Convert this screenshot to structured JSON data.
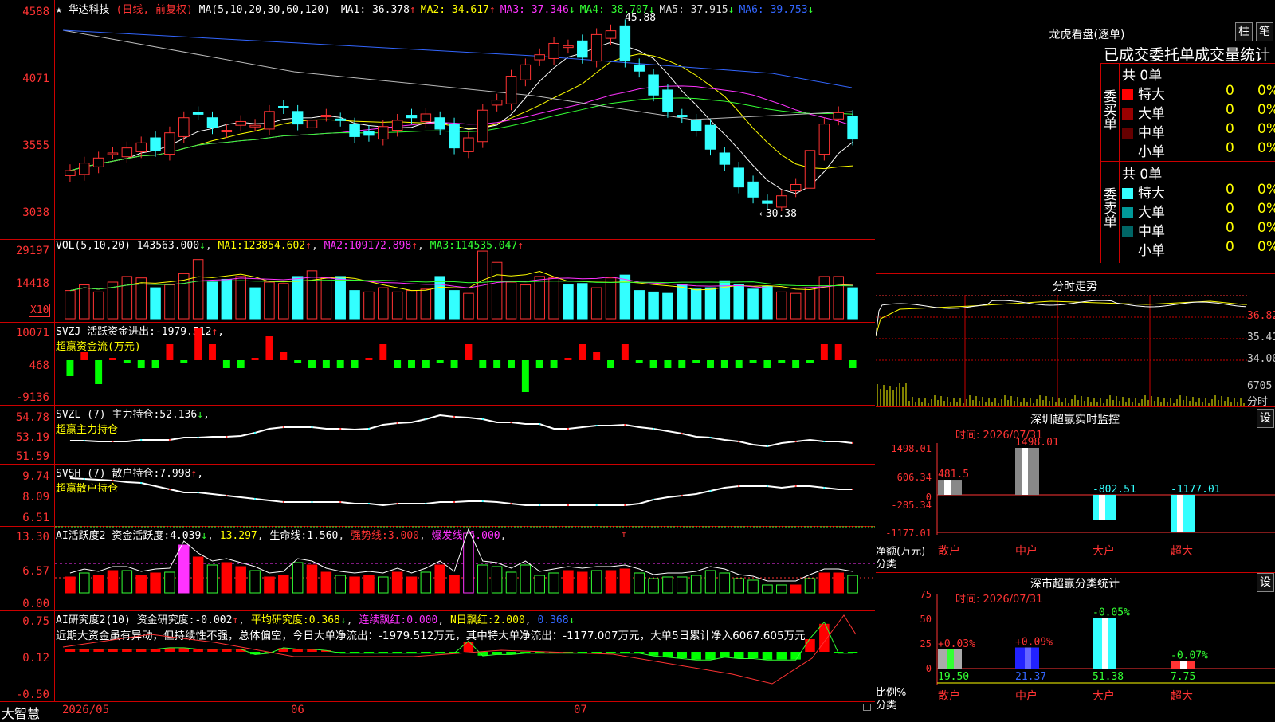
{
  "stock": {
    "name": "华达科技",
    "mode": "(日线, 前复权)",
    "ma_label": "MA(5,10,20,30,60,120)"
  },
  "main_ma": [
    {
      "label": "MA1:",
      "value": "36.378",
      "arrow": "↑",
      "color": "#ffffff"
    },
    {
      "label": "MA2:",
      "value": "34.617",
      "arrow": "↑",
      "color": "#ffff00"
    },
    {
      "label": "MA3:",
      "value": "37.346",
      "arrow": "↓",
      "color": "#ff33ff"
    },
    {
      "label": "MA4:",
      "value": "38.707",
      "arrow": "↓",
      "color": "#33ff33"
    },
    {
      "label": "MA5:",
      "value": "37.915",
      "arrow": "↓",
      "color": "#dddddd"
    },
    {
      "label": "MA6:",
      "value": "39.753",
      "arrow": "↓",
      "color": "#3366ff"
    }
  ],
  "price_ticks": [
    "4588",
    "4071",
    "3555",
    "3038"
  ],
  "price_high_label": "45.88",
  "price_low_label": "←30.38",
  "vol": {
    "label": "VOL(5,10,20)",
    "value": "143563.000",
    "arrow": "↓",
    "ma": [
      {
        "label": "MA1:",
        "value": "123854.602",
        "arrow": "↑"
      },
      {
        "label": "MA2:",
        "value": "109172.898",
        "arrow": "↑"
      },
      {
        "label": "MA3:",
        "value": "114535.047",
        "arrow": "↑"
      }
    ],
    "ticks": [
      "29197",
      "14418"
    ],
    "unit": "X10"
  },
  "svzj": {
    "label": "SVZJ",
    "title": "活跃资金进出:",
    "value": "-1979.512",
    "arrow": "↑",
    "suffix": ",",
    "sub": "超赢资金流(万元)",
    "ticks": [
      "10071",
      "468",
      "-9136"
    ]
  },
  "svzl": {
    "label": "SVZL (7)",
    "title": "主力持仓:",
    "value": "52.136",
    "arrow": "↓",
    "suffix": ",",
    "sub": "超赢主力持仓",
    "ticks": [
      "54.78",
      "53.19",
      "51.59"
    ]
  },
  "svsh": {
    "label": "SVSH (7)",
    "title": "散户持仓:",
    "value": "7.998",
    "arrow": "↑",
    "suffix": ",",
    "sub": "超赢散户持仓",
    "ticks": [
      "9.74",
      "8.09",
      "6.51"
    ]
  },
  "ai1": {
    "label": "AI活跃度2",
    "title": "资金活跃度:",
    "value": "4.039",
    "arrow": "↓",
    "v2": "13.297",
    "v3l": "生命线:",
    "v3": "1.560",
    "v4l": "强势线:",
    "v4": "3.000",
    "v5l": "爆发线:",
    "v5": "6.000",
    "ticks": [
      "13.30",
      "6.57",
      "0.00"
    ]
  },
  "ai2": {
    "label": "AI研究度2(10)",
    "title": "资金研究度:",
    "value": "-0.002",
    "arrow": "↑",
    "v2l": "平均研究度:",
    "v2": "0.368",
    "v2a": "↓",
    "v3l": "连续飘红:",
    "v3": "0.000",
    "v4l": "N日飘红:",
    "v4": "2.000",
    "v5": "0.368",
    "v5a": "↓",
    "comment": "近期大资金虽有异动，但持续性不强，总体偏空，今日大单净流出：-1979.512万元，其中特大单净流出：-1177.007万元，大单5日累计净入6067.605万元",
    "ticks": [
      "0.75",
      "0.12",
      "-0.50"
    ]
  },
  "dates": [
    "2026/05",
    "06",
    "07"
  ],
  "brand": "大智慧",
  "lhb": {
    "title": "龙虎看盘(逐单)",
    "btn1": "柱",
    "btn2": "笔",
    "header": "已成交委托单成交量统计",
    "buy_side": "委买单",
    "sell_side": "委卖单",
    "buy_total": "共 0单",
    "sell_total": "共 0单",
    "buy_rows": [
      {
        "name": "特大",
        "v": "0",
        "p": "0%",
        "c": "#ff0000"
      },
      {
        "name": "大单",
        "v": "0",
        "p": "0%",
        "c": "#990000"
      },
      {
        "name": "中单",
        "v": "0",
        "p": "0%",
        "c": "#660000"
      },
      {
        "name": "小单",
        "v": "0",
        "p": "0%",
        "c": "#000000"
      }
    ],
    "sell_rows": [
      {
        "name": "特大",
        "v": "0",
        "p": "0%",
        "c": "#33ffff"
      },
      {
        "name": "大单",
        "v": "0",
        "p": "0%",
        "c": "#009999"
      },
      {
        "name": "中单",
        "v": "0",
        "p": "0%",
        "c": "#006666"
      },
      {
        "name": "小单",
        "v": "0",
        "p": "0%",
        "c": "#000000"
      }
    ]
  },
  "fs": {
    "title": "分时走势",
    "ticks": [
      "36.82",
      "35.41",
      "34.00",
      "6705"
    ],
    "unit": "分时"
  },
  "sz": {
    "title": "深圳超赢实时监控",
    "btn": "设",
    "time": "时间: 2026/07/31",
    "ticks": [
      "1498.01",
      "606.34",
      "0",
      "-285.34",
      "-1177.01"
    ],
    "ylabel": "净额(万元)",
    "xlabel": "分类",
    "cats": [
      "散户",
      "中户",
      "大户",
      "超大"
    ],
    "vals": [
      "481.5",
      "1498.01",
      "-802.51",
      "-1177.01"
    ]
  },
  "sc": {
    "title": "深市超赢分类统计",
    "btn": "设",
    "time": "时间: 2026/07/31",
    "ticks": [
      "75",
      "50",
      "25",
      "0"
    ],
    "ylabel": "比例%",
    "xlabel": "分类",
    "cats": [
      "散户",
      "中户",
      "大户",
      "超大"
    ],
    "vals": [
      "19.50",
      "21.37",
      "51.38",
      "7.75"
    ],
    "chg": [
      "+0.03%",
      "+0.09%",
      "-0.05%",
      "-0.07%"
    ]
  },
  "chart_data": [
    {
      "type": "candlestick",
      "title": "华达科技 日线",
      "ylim": [
        30.38,
        45.88
      ],
      "high": 45.88,
      "low": 30.38,
      "close": [
        33.6,
        34.2,
        34.6,
        35.0,
        35.4,
        35.8,
        35.2,
        36.6,
        37.8,
        38.1,
        37.0,
        36.8,
        37.5,
        37.2,
        38.3,
        38.6,
        37.3,
        37.6,
        38.0,
        37.6,
        36.3,
        36.4,
        37.1,
        37.6,
        37.8,
        38.1,
        36.9,
        35.4,
        36.2,
        38.4,
        39.2,
        41.1,
        42.0,
        42.8,
        43.7,
        43.5,
        42.6,
        44.4,
        44.7,
        42.3,
        41.5,
        39.6,
        38.3,
        37.9,
        36.8,
        35.3,
        34.1,
        32.3,
        31.5,
        31.0,
        31.6,
        32.5,
        35.2,
        37.3,
        38.2,
        36.1
      ],
      "volume": [
        100,
        120,
        95,
        130,
        150,
        145,
        110,
        120,
        160,
        210,
        130,
        140,
        150,
        110,
        130,
        125,
        150,
        170,
        145,
        150,
        100,
        95,
        110,
        95,
        100,
        105,
        150,
        100,
        90,
        240,
        200,
        130,
        120,
        150,
        145,
        120,
        125,
        110,
        145,
        155,
        100,
        95,
        90,
        120,
        105,
        110,
        135,
        120,
        105,
        115,
        95,
        90,
        110,
        150,
        150,
        110
      ]
    }
  ]
}
